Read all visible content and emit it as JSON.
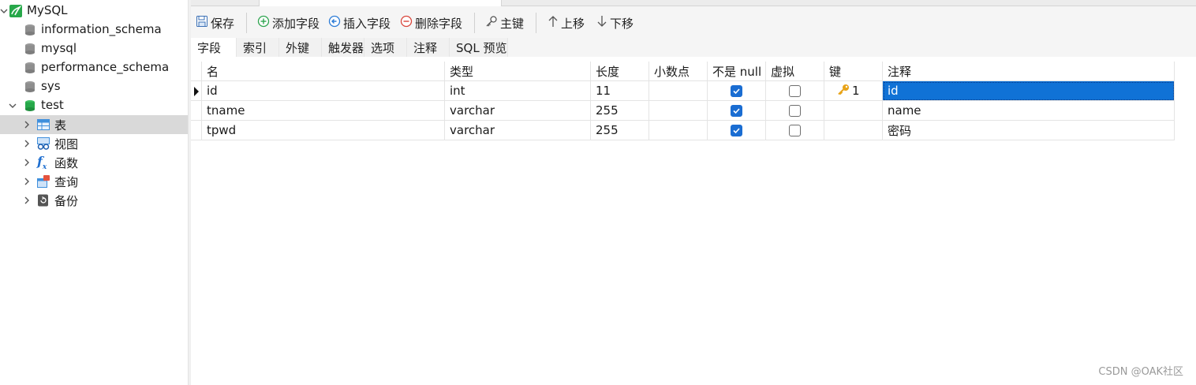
{
  "sidebar": {
    "connection": {
      "label": "MySQL"
    },
    "databases": [
      {
        "label": "information_schema"
      },
      {
        "label": "mysql"
      },
      {
        "label": "performance_schema"
      },
      {
        "label": "sys"
      },
      {
        "label": "test"
      }
    ],
    "test_children": [
      {
        "label": "表",
        "icon": "table-icon",
        "selected": true
      },
      {
        "label": "视图",
        "icon": "view-icon"
      },
      {
        "label": "函数",
        "icon": "function-icon"
      },
      {
        "label": "查询",
        "icon": "query-icon"
      },
      {
        "label": "备份",
        "icon": "backup-icon"
      }
    ]
  },
  "toolbar": {
    "save_label": "保存",
    "add_field_label": "添加字段",
    "insert_field_label": "插入字段",
    "delete_field_label": "删除字段",
    "primary_key_label": "主键",
    "move_up_label": "上移",
    "move_down_label": "下移"
  },
  "subtabs": [
    "字段",
    "索引",
    "外键",
    "触发器",
    "选项",
    "注释",
    "SQL 预览"
  ],
  "grid": {
    "columns": [
      "名",
      "类型",
      "长度",
      "小数点",
      "不是 null",
      "虚拟",
      "键",
      "注释"
    ],
    "rows": [
      {
        "name": "id",
        "type": "int",
        "length": "11",
        "decimals": "",
        "not_null": true,
        "virtual": false,
        "key": "1",
        "comment": "id"
      },
      {
        "name": "tname",
        "type": "varchar",
        "length": "255",
        "decimals": "",
        "not_null": true,
        "virtual": false,
        "key": "",
        "comment": "name"
      },
      {
        "name": "tpwd",
        "type": "varchar",
        "length": "255",
        "decimals": "",
        "not_null": true,
        "virtual": false,
        "key": "",
        "comment": "密码"
      }
    ]
  },
  "watermark": "CSDN @OAK社区",
  "colors": {
    "accent": "#1072d6",
    "db_green": "#27a84a",
    "key_gold": "#e8a317"
  }
}
